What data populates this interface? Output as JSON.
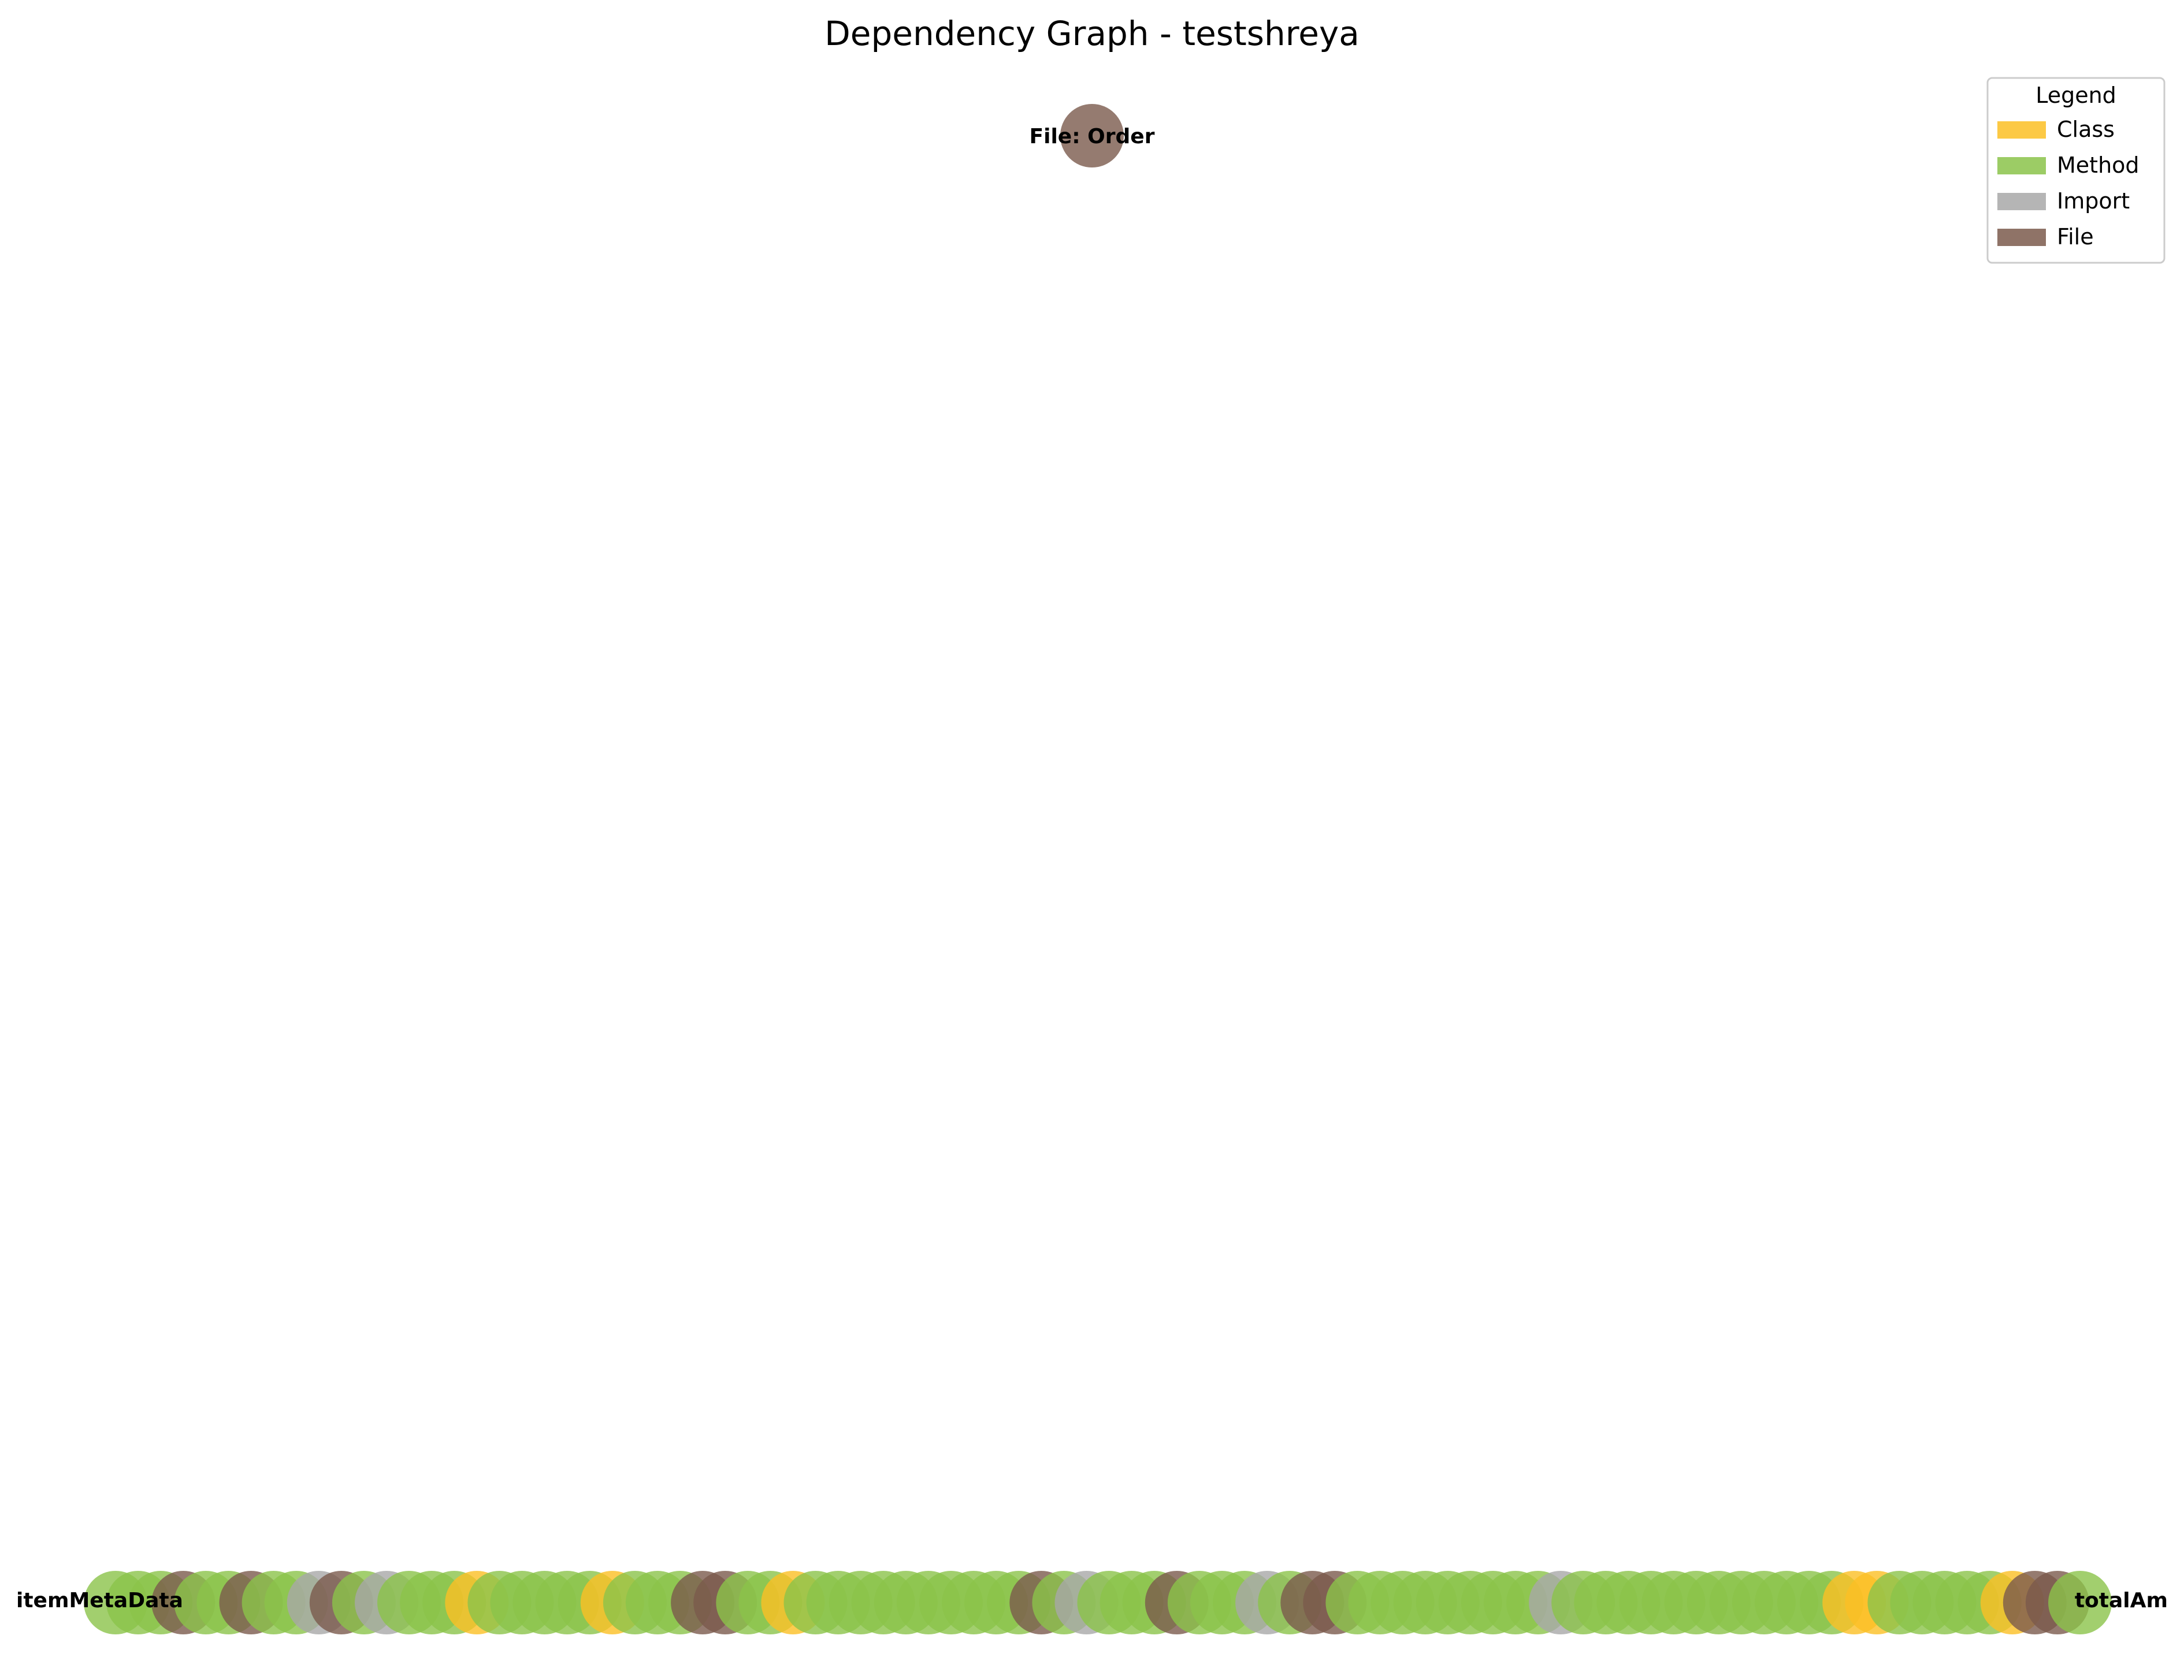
{
  "title": "Dependency Graph - testshreya",
  "legend": {
    "title": "Legend",
    "items": [
      {
        "label": "Class",
        "color": "#fbbf24"
      },
      {
        "label": "Method",
        "color": "#8bc34a"
      },
      {
        "label": "Import",
        "color": "#a8a8a8"
      },
      {
        "label": "File",
        "color": "#7b5a4c"
      }
    ]
  },
  "root_node": {
    "label": "File: Order",
    "type": "File"
  },
  "row_node_types": "MMMFMMFMMIFMIMMMCMMMMMCMMMFFMMCMMMMMMMMMMFMIMMMFMMMIMFFMMMMMMMMMIMMMMMMMMMMMMCCMMMMMCFFM",
  "row_edge_labels": {
    "left": "itemMetaData",
    "right": "totalAm"
  }
}
